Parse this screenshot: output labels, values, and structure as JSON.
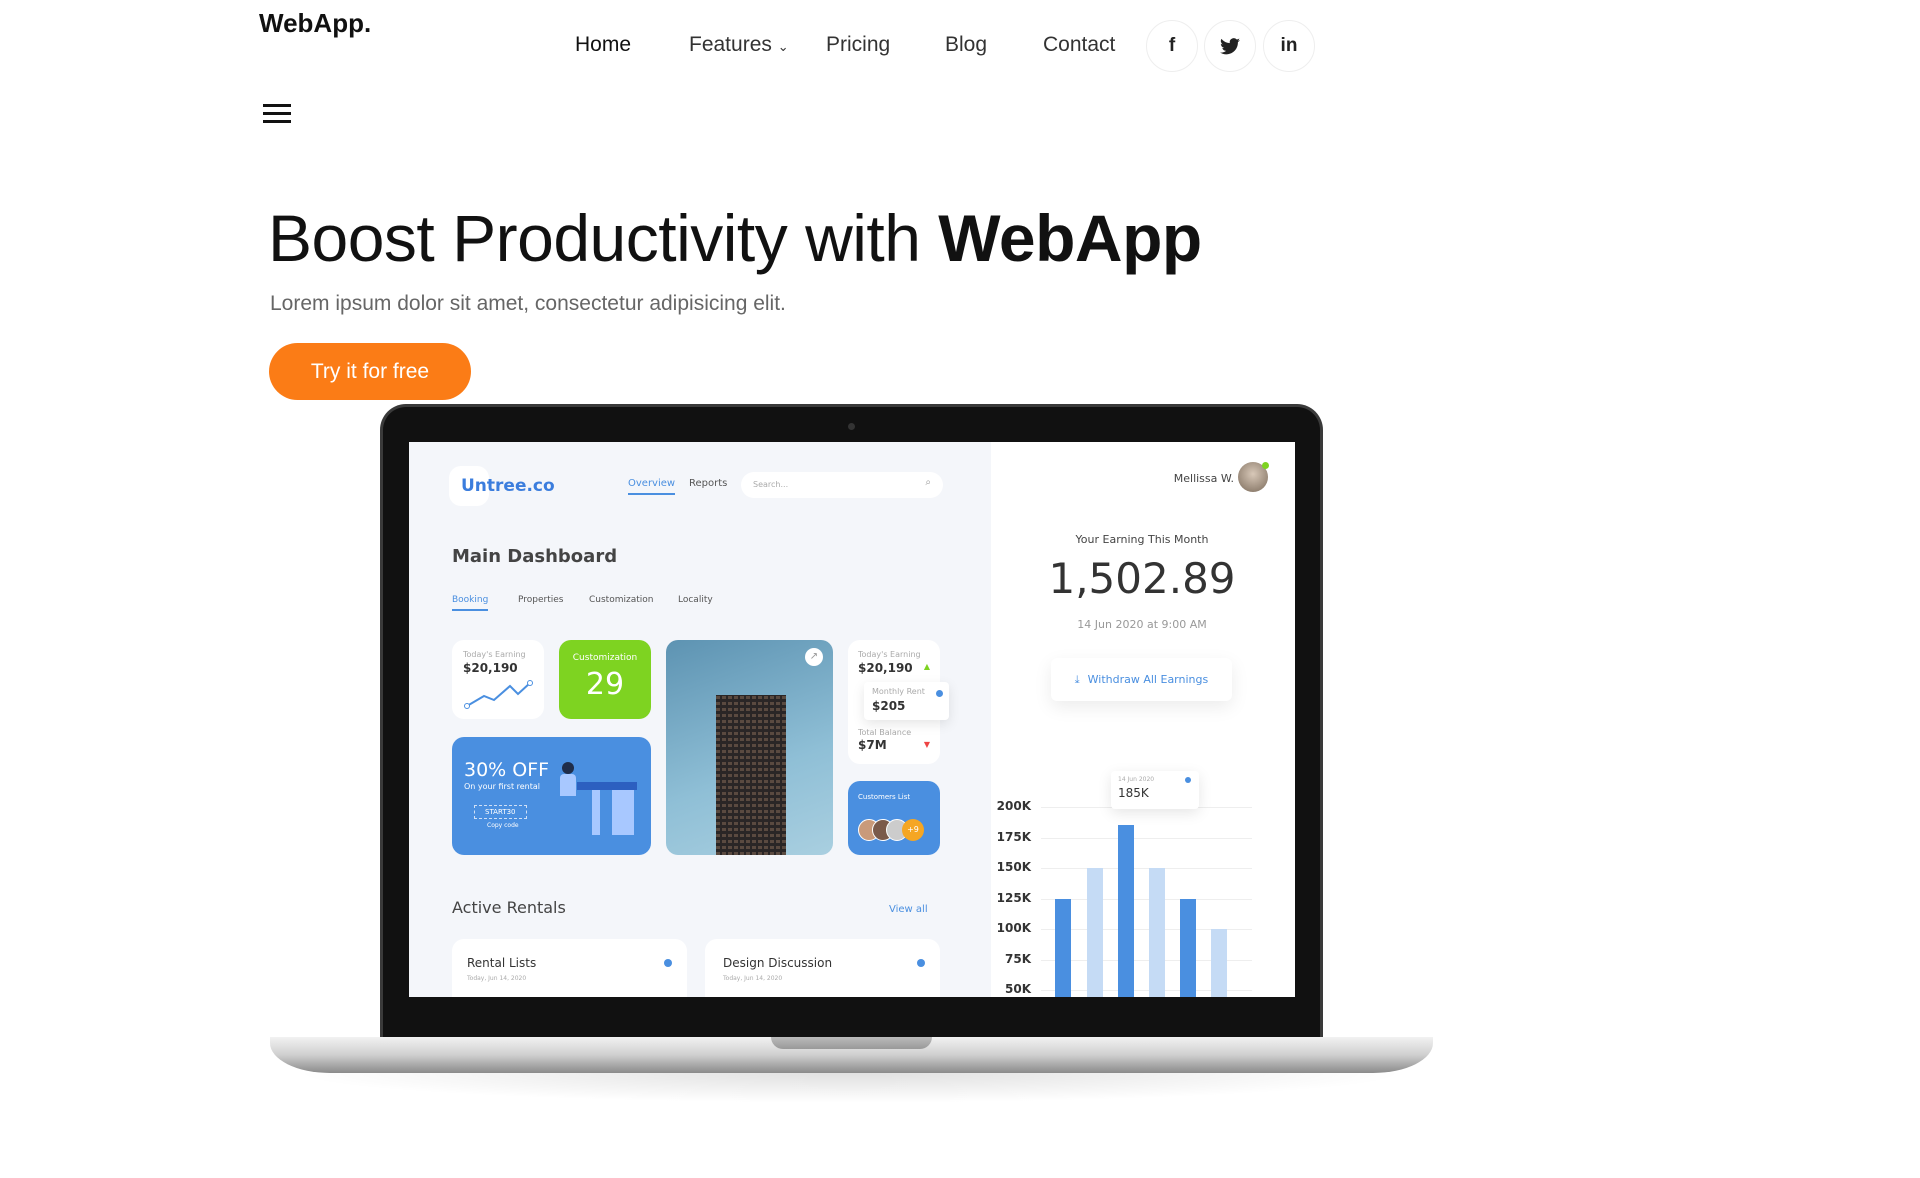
{
  "brand": "WebApp.",
  "nav": {
    "items": [
      {
        "label": "Home",
        "active": true
      },
      {
        "label": "Features",
        "has_dropdown": true
      },
      {
        "label": "Pricing"
      },
      {
        "label": "Blog"
      },
      {
        "label": "Contact"
      }
    ],
    "social": [
      {
        "icon": "facebook-icon",
        "glyph": "f"
      },
      {
        "icon": "twitter-icon",
        "glyph": "🐦"
      },
      {
        "icon": "linkedin-icon",
        "glyph": "in"
      }
    ]
  },
  "hero": {
    "title_pre": "Boost Productivity with ",
    "title_bold": "WebApp",
    "subtitle": "Lorem ipsum dolor sit amet, consectetur adipisicing elit.",
    "cta": "Try it for free",
    "cta_color": "#fb7c16"
  },
  "mockup": {
    "logo": "Untree.co",
    "tabs_top": [
      "Overview",
      "Reports"
    ],
    "search_placeholder": "Search...",
    "title": "Main Dashboard",
    "tabs": [
      "Booking",
      "Properties",
      "Customization",
      "Locality"
    ],
    "card_earning": {
      "label": "Today's Earning",
      "value": "$20,190"
    },
    "card_custom": {
      "label": "Customization",
      "value": "29"
    },
    "card_offer": {
      "title": "30% OFF",
      "sub": "On your first rental",
      "code": "START30",
      "copy": "Copy code"
    },
    "card_stats": {
      "label1": "Today's Earning",
      "value1": "$20,190",
      "popup_label": "Monthly Rent",
      "popup_value": "$205",
      "label2": "Total Balance",
      "value2": "$7M"
    },
    "customers": {
      "label": "Customers List",
      "more": "+9"
    },
    "active_rentals": "Active Rentals",
    "view_all": "View all",
    "rentals": [
      {
        "title": "Rental Lists",
        "date": "Today, Jun 14, 2020"
      },
      {
        "title": "Design Discussion",
        "date": "Today, Jun 14, 2020"
      }
    ],
    "user": "Mellissa W.",
    "earning_label": "Your Earning This Month",
    "earning_value": "1,502.89",
    "earning_date": "14 Jun 2020 at 9:00 AM",
    "withdraw": "Withdraw All Earnings",
    "accent": "#4a8fe0"
  },
  "chart_data": {
    "type": "bar",
    "yticks": [
      "200K",
      "175K",
      "150K",
      "125K",
      "100K",
      "75K",
      "50K"
    ],
    "values": [
      125,
      150,
      185,
      150,
      125,
      100
    ],
    "unit": "K",
    "highlight": [
      true,
      false,
      true,
      false,
      true,
      false
    ],
    "tooltip": {
      "date": "14 Jun 2020",
      "value": "185K"
    },
    "ylim": [
      50,
      200
    ],
    "grid": true
  }
}
